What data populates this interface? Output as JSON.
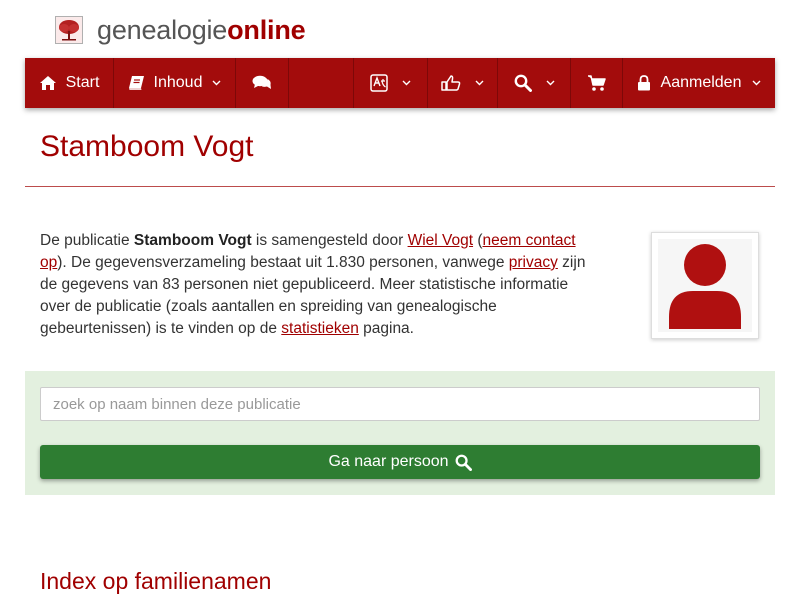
{
  "brand": {
    "part1": "genealogie",
    "part2": "online",
    "logo_icon": "tree-icon"
  },
  "nav": {
    "start": "Start",
    "inhoud": "Inhoud",
    "aanmelden": "Aanmelden",
    "icons": {
      "start": "home-icon",
      "inhoud": "book-icon",
      "chat": "comments-icon",
      "language": "translate-icon",
      "share": "thumbs-up-icon",
      "search": "search-icon",
      "cart": "shopping-cart-icon",
      "login": "lock-icon"
    }
  },
  "page_title": "Stamboom Vogt",
  "intro": {
    "t1": "De publicatie ",
    "publication": "Stamboom Vogt",
    "t2": " is samengesteld door ",
    "author": "Wiel Vogt",
    "t3": " (",
    "contact": "neem contact op",
    "t4": "). De gegevensverzameling bestaat uit 1.830 personen, vanwege ",
    "privacy": "privacy",
    "t5": " zijn de gegevens van 83 personen niet gepubliceerd. Meer statistische informatie over de publicatie (zoals aantallen en spreiding van genealogische gebeurtenissen) is te vinden op de ",
    "stats": "statistieken",
    "t6": " pagina."
  },
  "search": {
    "placeholder": "zoek op naam binnen deze publicatie",
    "value": "",
    "button": "Ga naar persoon"
  },
  "section_title": "Index op familienamen",
  "colors": {
    "brand_red": "#a30c0c",
    "title_red": "#a00000",
    "button_green": "#2e7d32",
    "panel_green": "#e3f0df"
  }
}
